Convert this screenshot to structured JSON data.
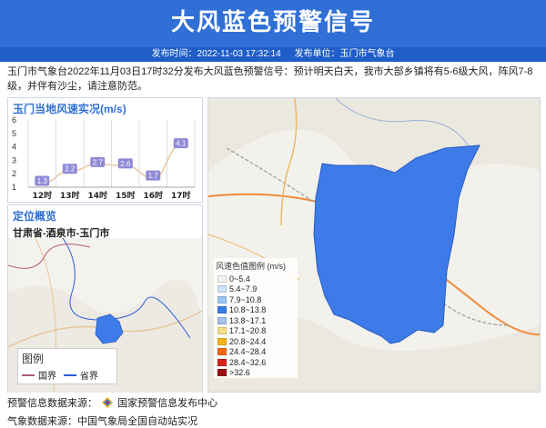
{
  "header": {
    "title": "大风蓝色预警信号",
    "publish_time": "发布时间：2022-11-03 17:32:14",
    "publisher": "发布单位：玉门市气象台"
  },
  "summary": "玉门市气象台2022年11月03日17时32分发布大风蓝色预警信号：预计明天白天，我市大部乡镇将有5-6级大风，阵风7-8级，并伴有沙尘，请注意防范。",
  "wind_panel": {
    "title": "玉门当地风速实况",
    "unit": "(m/s)"
  },
  "chart_data": {
    "type": "line",
    "categories": [
      "12时",
      "13时",
      "14时",
      "15时",
      "16时",
      "17时"
    ],
    "values": [
      1.3,
      2.2,
      2.7,
      2.6,
      1.7,
      4.1
    ],
    "ylim": [
      1,
      6
    ],
    "yticks": [
      "1",
      "2",
      "3",
      "4",
      "5",
      "6"
    ],
    "labels": [
      "1.3",
      "2.2",
      "2.7",
      "2.6",
      "1.7",
      "4.1"
    ],
    "grid": true
  },
  "location": {
    "title": "定位概览",
    "region": "甘肃省-酒泉市-玉门市"
  },
  "map_legend": {
    "title": "图例",
    "items": [
      {
        "label": "国界",
        "color": "#b05a7a"
      },
      {
        "label": "省界",
        "color": "#2f5bd6"
      }
    ]
  },
  "wind_scale": {
    "title": "风速色值图例 (m/s)",
    "items": [
      {
        "label": "0~5.4",
        "color": "#f2f2f2"
      },
      {
        "label": "5.4~7.9",
        "color": "#cfe3fb"
      },
      {
        "label": "7.9~10.8",
        "color": "#9cc8f7"
      },
      {
        "label": "10.8~13.8",
        "color": "#3d7be8"
      },
      {
        "label": "13.8~17.1",
        "color": "#a9c0ea"
      },
      {
        "label": "17.1~20.8",
        "color": "#f7e08a"
      },
      {
        "label": "20.8~24.4",
        "color": "#f5b418"
      },
      {
        "label": "24.4~28.4",
        "color": "#ee6a12"
      },
      {
        "label": "28.4~32.6",
        "color": "#d8251b"
      },
      {
        "label": ">32.6",
        "color": "#9a0f0f"
      }
    ]
  },
  "footer": {
    "warning_source_label": "预警信息数据来源：",
    "warning_source": "国家预警信息发布中心",
    "weather_source": "气象数据来源：中国气象局全国自动站实况"
  }
}
